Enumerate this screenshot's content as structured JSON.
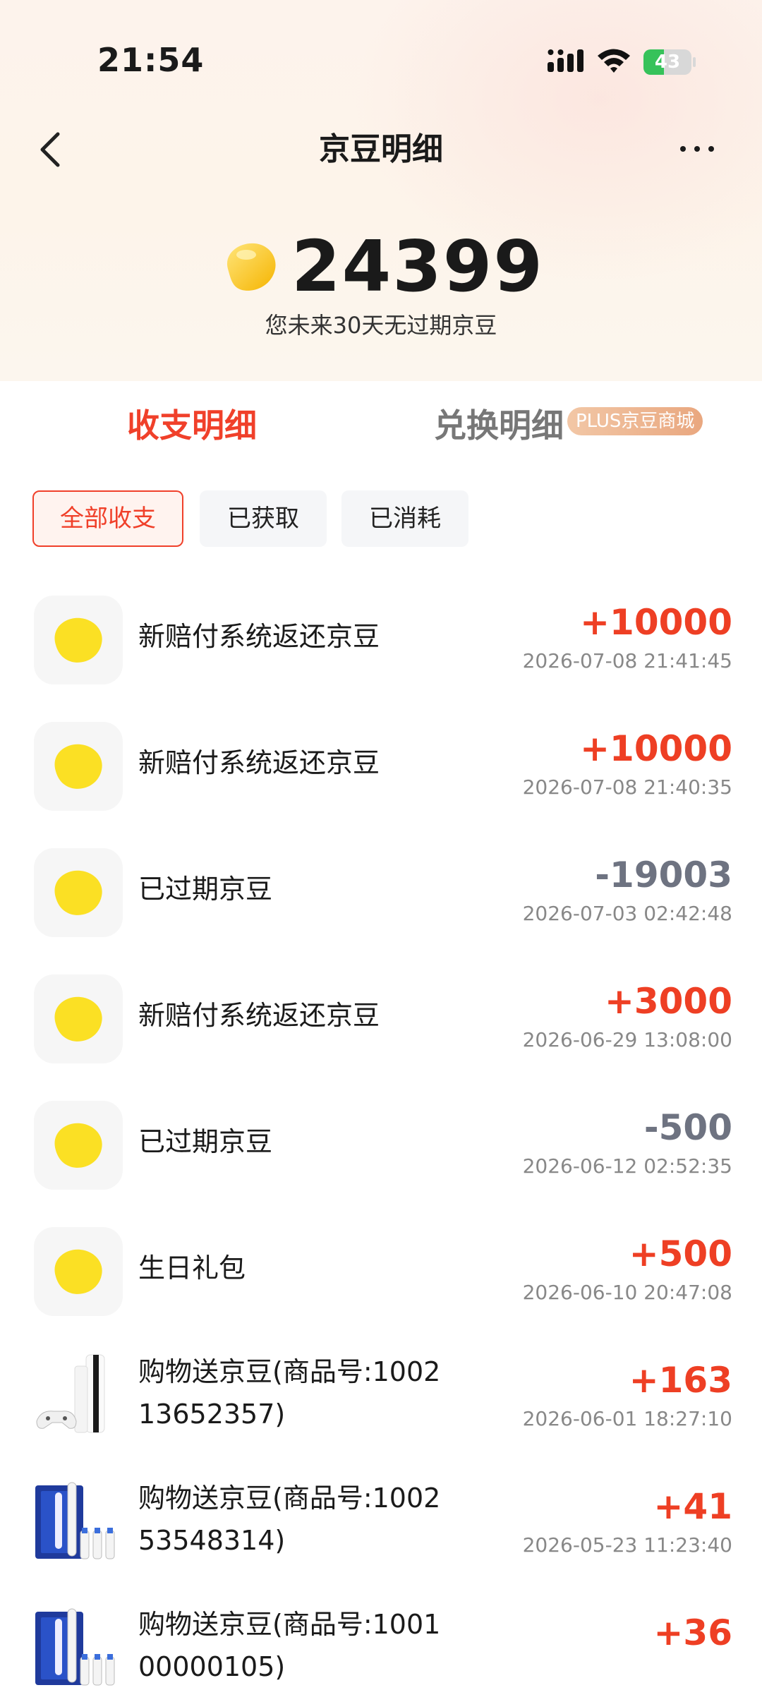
{
  "status_bar": {
    "time": "21:54",
    "battery": "43"
  },
  "header": {
    "title": "京豆明细"
  },
  "balance": {
    "amount": "24399",
    "note": "您未来30天无过期京豆"
  },
  "tabs": {
    "income": "收支明细",
    "exchange": "兑换明细",
    "badge": "PLUS京豆商城"
  },
  "filters": [
    "全部收支",
    "已获取",
    "已消耗"
  ],
  "records": [
    {
      "title": "新赔付系统返还京豆",
      "amount": "+10000",
      "date": "2026-07-08 21:41:45",
      "sign": "plus",
      "icon": "bean-icon"
    },
    {
      "title": "新赔付系统返还京豆",
      "amount": "+10000",
      "date": "2026-07-08 21:40:35",
      "sign": "plus",
      "icon": "bean-icon"
    },
    {
      "title": "已过期京豆",
      "amount": "-19003",
      "date": "2026-07-03 02:42:48",
      "sign": "minus",
      "icon": "bean-icon"
    },
    {
      "title": "新赔付系统返还京豆",
      "amount": "+3000",
      "date": "2026-06-29 13:08:00",
      "sign": "plus",
      "icon": "bean-icon"
    },
    {
      "title": "已过期京豆",
      "amount": "-500",
      "date": "2026-06-12 02:52:35",
      "sign": "minus",
      "icon": "bean-icon"
    },
    {
      "title": "生日礼包",
      "amount": "+500",
      "date": "2026-06-10 20:47:08",
      "sign": "plus",
      "icon": "bean-icon"
    },
    {
      "title": "购物送京豆(商品号:1002\n13652357)",
      "amount": "+163",
      "date": "2026-06-01 18:27:10",
      "sign": "plus",
      "icon": "console-product-icon"
    },
    {
      "title": "购物送京豆(商品号:1002\n53548314)",
      "amount": "+41",
      "date": "2026-05-23 11:23:40",
      "sign": "plus",
      "icon": "toothbrush-product-icon"
    },
    {
      "title": "购物送京豆(商品号:1001\n00000105)",
      "amount": "+36",
      "date": "",
      "sign": "plus",
      "icon": "toothbrush-product-icon"
    }
  ],
  "colors": {
    "accent": "#f0402a",
    "plus": "#ee3f24",
    "minus": "#6e7381",
    "bean": "#fbe024"
  }
}
